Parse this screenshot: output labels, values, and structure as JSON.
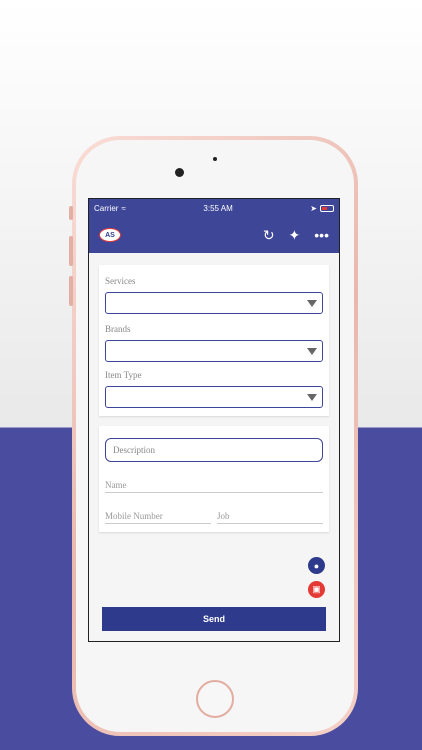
{
  "status_bar": {
    "carrier": "Carrier",
    "time": "3:55 AM"
  },
  "app_bar": {
    "logo_text": "AS",
    "actions": [
      "refresh-icon",
      "ticket-icon",
      "more-icon"
    ]
  },
  "form": {
    "services_label": "Services",
    "brands_label": "Brands",
    "item_type_label": "Item Type",
    "description_placeholder": "Description",
    "name_placeholder": "Name",
    "mobile_placeholder": "Mobile Number",
    "job_placeholder": "Job"
  },
  "send_label": "Send",
  "colors": {
    "primary": "#3d4697",
    "button": "#2e3a8c",
    "accent": "#e53935"
  }
}
